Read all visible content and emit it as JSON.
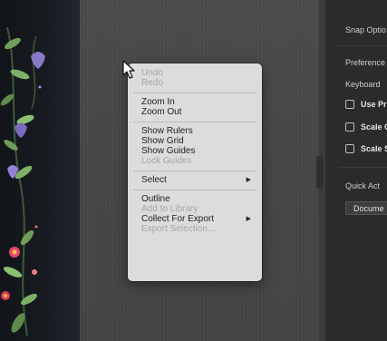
{
  "context_menu": {
    "groups": [
      [
        {
          "label": "Undo",
          "enabled": false
        },
        {
          "label": "Redo",
          "enabled": false
        }
      ],
      [
        {
          "label": "Zoom In",
          "enabled": true
        },
        {
          "label": "Zoom Out",
          "enabled": true
        }
      ],
      [
        {
          "label": "Show Rulers",
          "enabled": true
        },
        {
          "label": "Show Grid",
          "enabled": true
        },
        {
          "label": "Show Guides",
          "enabled": true
        },
        {
          "label": "Lock Guides",
          "enabled": false
        }
      ],
      [
        {
          "label": "Select",
          "enabled": true,
          "submenu": true
        }
      ],
      [
        {
          "label": "Outline",
          "enabled": true
        },
        {
          "label": "Add to Library",
          "enabled": false
        },
        {
          "label": "Collect For Export",
          "enabled": true,
          "submenu": true
        },
        {
          "label": "Export Selection...",
          "enabled": false
        }
      ]
    ]
  },
  "panel": {
    "snap_options_label": "Snap Optio",
    "preferences_label": "Preference",
    "keyboard_label": "Keyboard",
    "checkboxes": [
      "Use Pr",
      "Scale C",
      "Scale S"
    ],
    "quick_actions_label": "Quick Act",
    "document_button_label": "Docume"
  },
  "colors": {
    "canvas": "#48494b",
    "panel": "#2b2b2d",
    "menu": "#dcdcdc",
    "menu_text": "#1e1e1e",
    "menu_text_disabled": "#a4a4a4"
  }
}
